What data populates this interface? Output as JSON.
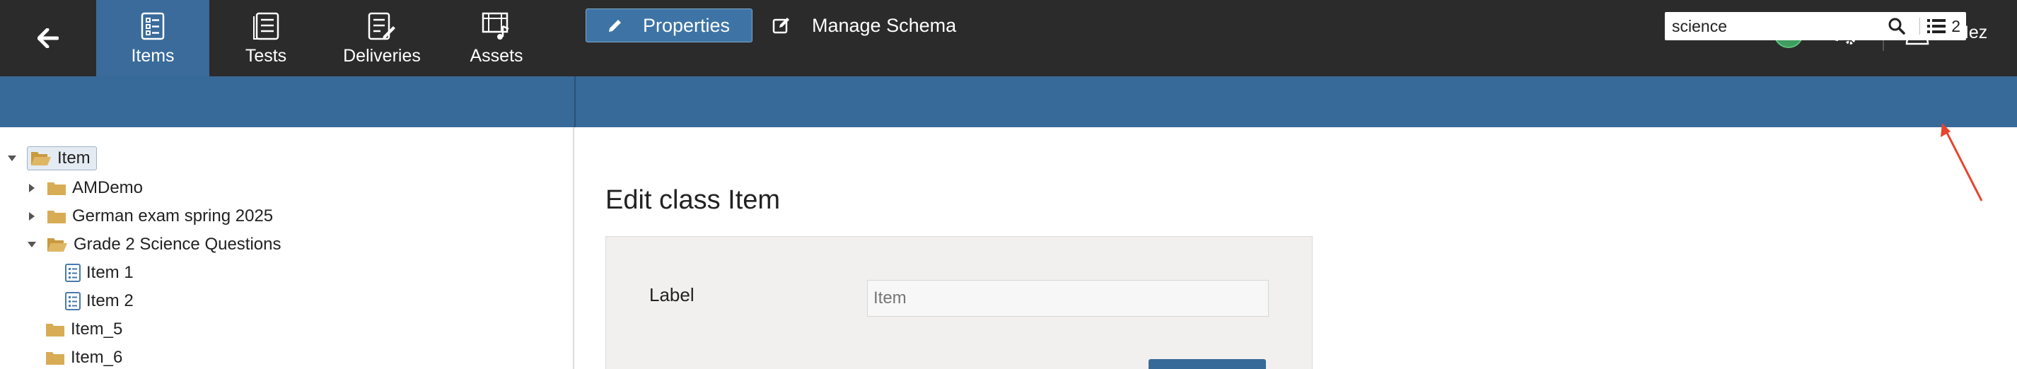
{
  "topnav": {
    "tabs": [
      {
        "label": "Items",
        "icon": "items-icon",
        "active": true
      },
      {
        "label": "Tests",
        "icon": "tests-icon",
        "active": false
      },
      {
        "label": "Deliveries",
        "icon": "deliveries-icon",
        "active": false
      },
      {
        "label": "Assets",
        "icon": "assets-icon",
        "active": false
      }
    ],
    "notifications_count": "31",
    "user_name": "N Mez"
  },
  "actionbar": {
    "properties_label": "Properties",
    "manage_schema_label": "Manage Schema",
    "search_value": "science",
    "results_count": "2"
  },
  "tree": {
    "root": "Item",
    "nodes": [
      "AMDemo",
      "German exam spring 2025",
      "Grade 2 Science Questions",
      "Item 1",
      "Item 2",
      "Item_5",
      "Item_6"
    ]
  },
  "form": {
    "title": "Edit class Item",
    "label_field_label": "Label",
    "label_field_placeholder": "Item"
  },
  "colors": {
    "topbar": "#2b2b2b",
    "accent_blue": "#376a98",
    "badge_green": "#3e9d5f",
    "annotation_red": "#e8432e"
  }
}
